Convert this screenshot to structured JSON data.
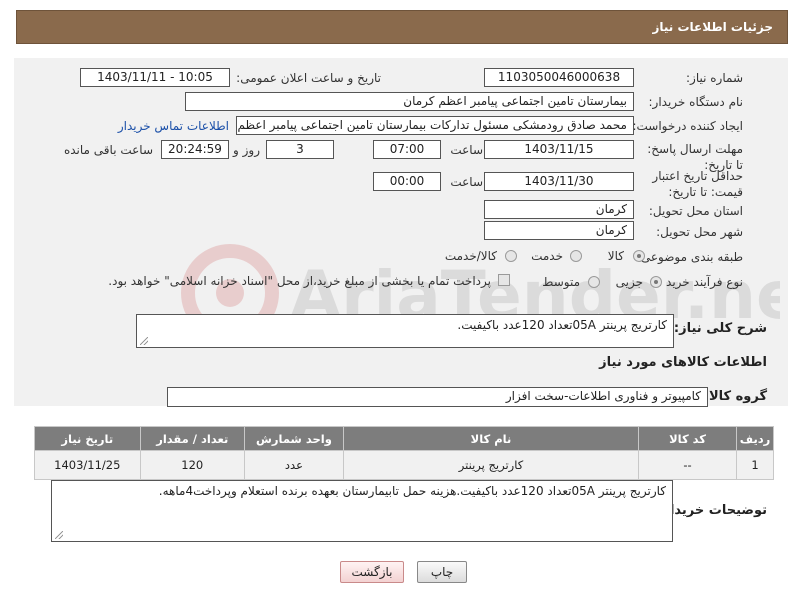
{
  "header": {
    "title": "جزئیات اطلاعات نیاز"
  },
  "fields": {
    "need_number_label": "شماره نیاز:",
    "need_number": "1103050046000638",
    "announce_label": "تاریخ و ساعت اعلان عمومی:",
    "announce_value": "1403/11/11 - 10:05",
    "buyer_org_label": "نام دستگاه خریدار:",
    "buyer_org": "بیمارستان تامین اجتماعی پیامبر اعظم کرمان",
    "creator_label": "ایجاد کننده درخواست:",
    "creator": "محمد صادق  رودمشکی مسئول تدارکات بیمارستان تامین اجتماعی پیامبر اعظم",
    "contact_link": "اطلاعات تماس خریدار",
    "deadline_label": "مهلت ارسال پاسخ: تا تاریخ:",
    "deadline_date": "1403/11/15",
    "time_label": "ساعت",
    "deadline_time": "07:00",
    "days_value": "3",
    "days_label": "روز و",
    "remaining_time": "20:24:59",
    "remaining_label": "ساعت باقی مانده",
    "validity_label": "حداقل تاریخ اعتبار قیمت: تا تاریخ:",
    "validity_date": "1403/11/30",
    "validity_time": "00:00",
    "province_label": "استان محل تحویل:",
    "province": "کرمان",
    "city_label": "شهر محل تحویل:",
    "city": "کرمان",
    "category_label": "طبقه بندی موضوعی:",
    "category_options": [
      "کالا",
      "خدمت",
      "کالا/خدمت"
    ],
    "process_label": "نوع فرآیند خرید :",
    "process_options": [
      "جزیی",
      "متوسط"
    ],
    "payment_note": "پرداخت تمام یا بخشی از مبلغ خرید،از محل \"اسناد خزانه اسلامی\" خواهد بود."
  },
  "summary": {
    "label": "شرح کلی نیاز:",
    "value": "کارتریج پرینتر 05Aتعداد 120عدد باکیفیت."
  },
  "goods_section_title": "اطلاعات کالاهای مورد نیاز",
  "goods_group": {
    "label": "گروه کالا:",
    "value": "کامپیوتر و فناوری اطلاعات-سخت افزار"
  },
  "table": {
    "headers": [
      "ردیف",
      "کد کالا",
      "نام کالا",
      "واحد شمارش",
      "تعداد / مقدار",
      "تاریخ نیاز"
    ],
    "rows": [
      [
        "1",
        "--",
        "کارتریج پرینتر",
        "عدد",
        "120",
        "1403/11/25"
      ]
    ]
  },
  "buyer_notes": {
    "label": "توضیحات خریدار:",
    "value": "کارتریج پرینتر 05Aتعداد 120عدد باکیفیت.هزینه حمل تابیمارستان بعهده برنده استعلام وپرداخت4ماهه."
  },
  "buttons": {
    "print": "چاپ",
    "back": "بازگشت"
  },
  "watermark_text": "AriaTender.net"
}
